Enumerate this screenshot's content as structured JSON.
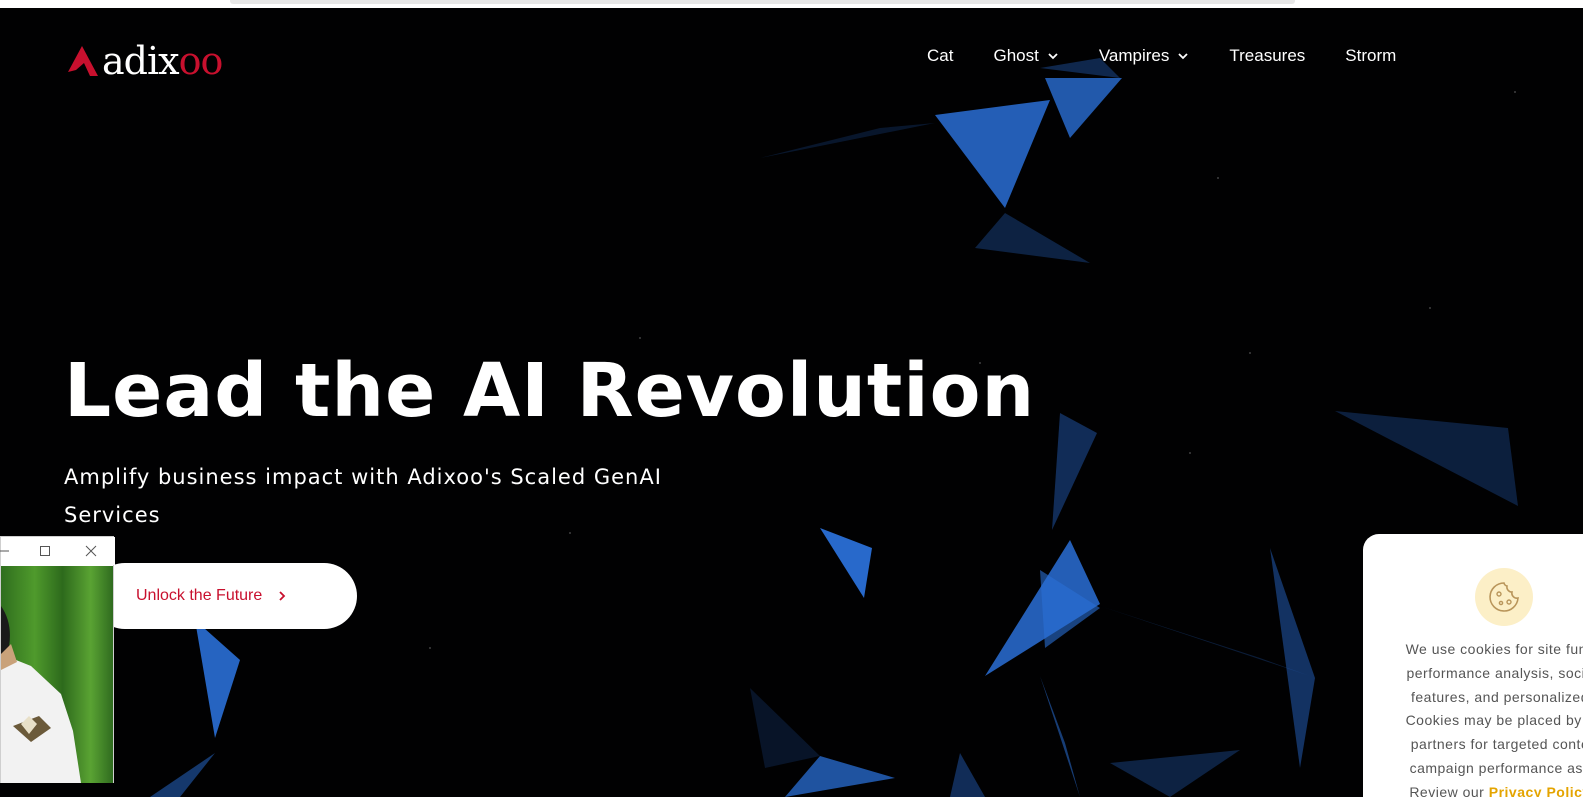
{
  "brand": {
    "logo_text": "adixoo",
    "logo_main": "adix",
    "logo_accent": "oo",
    "accent_color": "#c8102e"
  },
  "nav": {
    "items": [
      {
        "label": "Cat",
        "has_dropdown": false
      },
      {
        "label": "Ghost",
        "has_dropdown": true
      },
      {
        "label": "Vampires",
        "has_dropdown": true
      },
      {
        "label": "Treasures",
        "has_dropdown": false
      },
      {
        "label": "Strorm",
        "has_dropdown": false
      }
    ]
  },
  "hero": {
    "headline": "Lead the AI Revolution",
    "subheadline": "Amplify business impact with Adixoo's Scaled GenAI Services",
    "cta_label": "Unlock the Future",
    "background_color": "#010102",
    "shape_color": "#2a6fd6"
  },
  "webcam_window": {
    "controls": [
      "minimize-icon",
      "maximize-icon",
      "close-icon"
    ]
  },
  "cookie_notice": {
    "icon": "cookie-icon",
    "lines": [
      "We use cookies for site func",
      "performance analysis, socia",
      "features, and personalized",
      "Cookies may be placed by u",
      "partners for targeted conte",
      "campaign performance ass",
      "Review our"
    ],
    "policy_link": "Privacy Policy",
    "link_color": "#e4a400"
  }
}
